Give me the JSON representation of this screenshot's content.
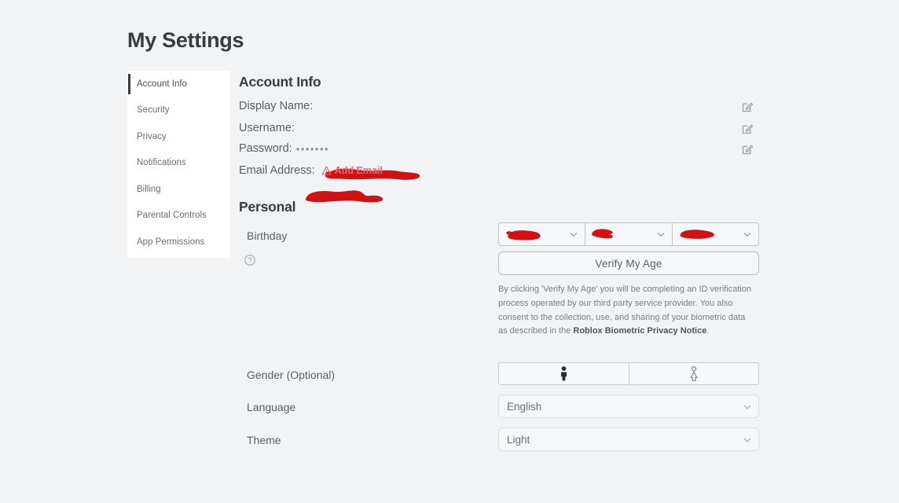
{
  "page": {
    "title": "My Settings"
  },
  "sidebar": {
    "items": [
      {
        "label": "Account Info",
        "active": true
      },
      {
        "label": "Security",
        "active": false
      },
      {
        "label": "Privacy",
        "active": false
      },
      {
        "label": "Notifications",
        "active": false
      },
      {
        "label": "Billing",
        "active": false
      },
      {
        "label": "Parental Controls",
        "active": false
      },
      {
        "label": "App Permissions",
        "active": false
      }
    ]
  },
  "account_info": {
    "heading": "Account Info",
    "display_name_label": "Display Name:",
    "display_name_value": "",
    "username_label": "Username:",
    "username_value": "",
    "password_label": "Password:",
    "password_value": "•••••••",
    "email_label": "Email Address:",
    "email_warning_text": "Add Email",
    "add_email_button": "Add Email"
  },
  "personal": {
    "heading": "Personal",
    "birthday_label": "Birthday",
    "birthday_month": "",
    "birthday_day": "",
    "birthday_year": "",
    "verify_age_button": "Verify My Age",
    "disclaimer_part1": "By clicking 'Verify My Age' you will be completing an ID verification process operated by our third party service provider. You also consent to the collection, use, and sharing of your biometric data as described in the ",
    "disclaimer_bold": "Roblox Biometric Privacy Notice",
    "disclaimer_part2": ".",
    "gender_label": "Gender (Optional)",
    "gender_male_icon": "male-figure-icon",
    "gender_female_icon": "female-figure-icon",
    "language_label": "Language",
    "language_value": "English",
    "theme_label": "Theme",
    "theme_value": "Light"
  },
  "colors": {
    "background": "#f2f3f4",
    "panel": "#ffffff",
    "text_dark": "#393b3d",
    "text_muted": "#6b6f74",
    "redaction": "#d21112",
    "warning": "#e8696b"
  }
}
